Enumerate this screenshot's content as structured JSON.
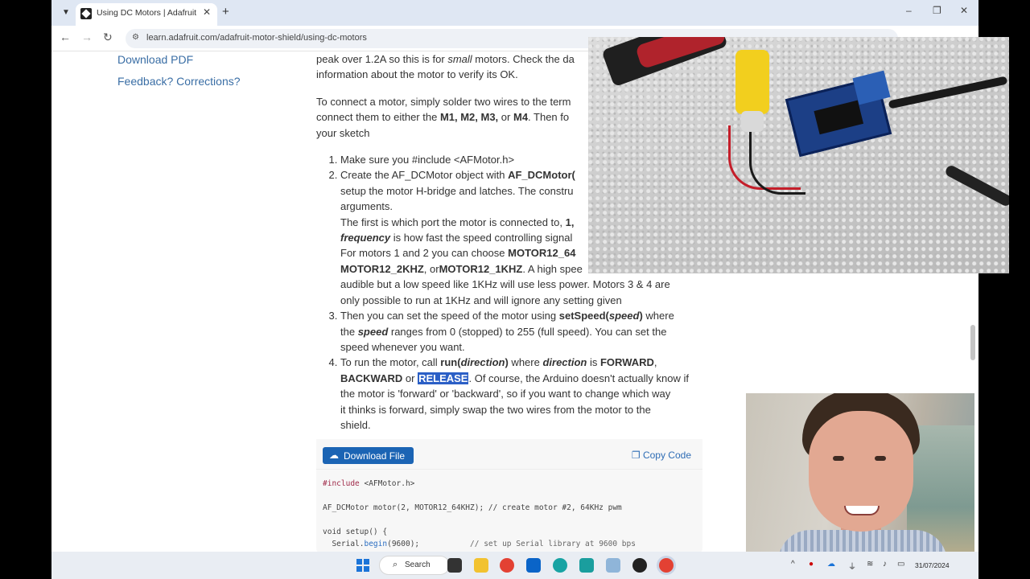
{
  "browser": {
    "tab_title": "Using DC Motors | Adafruit Mo",
    "url": "learn.adafruit.com/adafruit-motor-shield/using-dc-motors",
    "tab_list_icon": "chevron-down",
    "new_tab_label": "+",
    "tab_close_label": "✕",
    "back_label": "←",
    "forward_label": "→",
    "reload_label": "↻",
    "minimize_label": "–",
    "maximize_label": "❐",
    "close_label": "✕"
  },
  "sidebar": {
    "download_pdf": "Download PDF",
    "feedback": "Feedback? Corrections?"
  },
  "article": {
    "p1_a": "peak over 1.2A so this is for ",
    "p1_em": "small",
    "p1_b": " motors. Check the da",
    "p1_c": "information about the motor to verify its OK.",
    "p2_a": "To connect a motor, simply solder two wires to the term",
    "p2_b": "connect them to either the ",
    "p2_m": "M1, M2, M3,",
    "p2_or": " or ",
    "p2_m4": "M4",
    "p2_c": ". Then fo",
    "p2_d": "your sketch",
    "step1": "Make sure you #include <AFMotor.h>",
    "step2_a": "Create the AF_DCMotor object with ",
    "step2_b": "AF_DCMotor(",
    "step2_c": "setup the motor H-bridge and latches. The constru",
    "step2_d": "arguments.",
    "step2_e": "The first is which port the motor is connected to, ",
    "step2_e2": "1,",
    "step2_f": "frequency",
    "step2_g": " is how fast the speed controlling signal",
    "step2_h": "For motors 1 and 2 you can choose ",
    "step2_h2": "MOTOR12_64",
    "step2_i": "MOTOR12_2KHZ",
    "step2_i2": ", or",
    "step2_i3": "MOTOR12_1KHZ",
    "step2_i4": ". A high spee",
    "step2_j": "audible but a low speed like 1KHz will use less power. Motors 3 & 4 are",
    "step2_k": "only possible to run at 1KHz and will ignore any setting given",
    "step3_a": "Then you can set the speed of the motor using ",
    "step3_b": "setSpeed(",
    "step3_c": "speed",
    "step3_d": ")",
    "step3_e": " where",
    "step3_f": "the ",
    "step3_g": "speed",
    "step3_h": " ranges from 0 (stopped) to 255 (full speed). You can set the",
    "step3_i": "speed whenever you want.",
    "step4_a": "To run the motor, call ",
    "step4_b": "run(",
    "step4_c": "direction",
    "step4_d": ")",
    "step4_e": " where ",
    "step4_f": "direction",
    "step4_g": " is ",
    "step4_h": "FORWARD",
    "step4_i": ",",
    "step4_j": "BACKWARD",
    "step4_k": " or ",
    "step4_l": "RELEASE",
    "step4_m": ". Of course, the Arduino doesn't actually know if",
    "step4_n": "the motor is 'forward' or 'backward', so if you want to change which way",
    "step4_o": "it thinks is forward, simply swap the two wires from the motor to the",
    "step4_p": "shield."
  },
  "code": {
    "download_label": "Download File",
    "copy_label": "Copy Code",
    "l1_kw": "#include",
    "l1_rest": " <AFMotor.h>",
    "l2": "AF_DCMotor motor(2, MOTOR12_64KHZ); // create motor #2, 64KHz pwm",
    "l3": "void setup() {",
    "l4_a": "  Serial.",
    "l4_fn": "begin",
    "l4_b": "(9600);",
    "l4_cm": "           // set up Serial library at 9600 bps"
  },
  "taskbar": {
    "search_label": "Search",
    "date": "31/07/2024"
  },
  "colors": {
    "link": "#3a6ea5",
    "highlight": "#2b5fc6",
    "download_button": "#1b64b4"
  }
}
